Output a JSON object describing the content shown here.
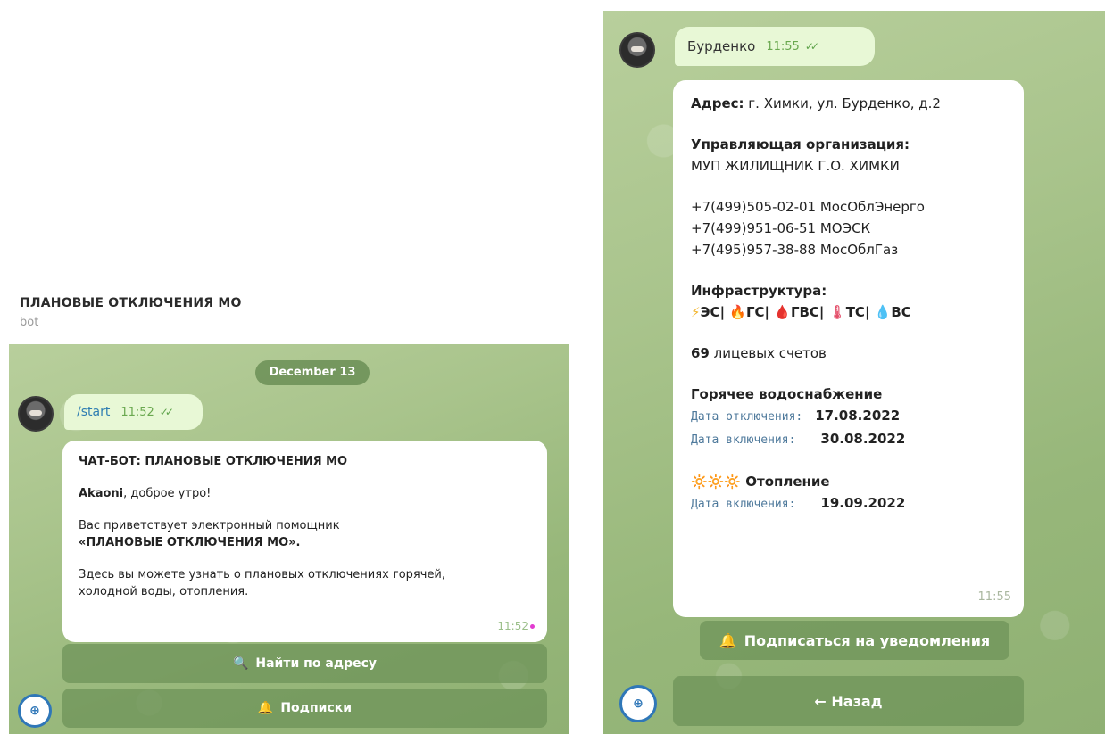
{
  "left": {
    "header": {
      "title": "ПЛАНОВЫЕ ОТКЛЮЧЕНИЯ МО",
      "subtitle": "bot"
    },
    "date_pill": "December 13",
    "outgoing": {
      "text": "/start",
      "time": "11:52",
      "check": "✓✓"
    },
    "message": {
      "title": "ЧАТ-БОТ: ПЛАНОВЫЕ ОТКЛЮЧЕНИЯ МО",
      "greeting_name": "Akaoni",
      "greeting_rest": ", доброе утро!",
      "line1": "Вас приветствует электронный помощник",
      "line2": "«ПЛАНОВЫЕ ОТКЛЮЧЕНИЯ МО».",
      "line3a": "Здесь вы можете узнать о плановых отключениях горячей,",
      "line3b": "холодной воды, отопления.",
      "time": "11:52"
    },
    "buttons": {
      "find": {
        "icon": "🔍",
        "label": "Найти по адресу"
      },
      "subs": {
        "icon": "🔔",
        "label": "Подписки"
      }
    },
    "bot_icon": "⊕"
  },
  "right": {
    "outgoing": {
      "text": "Бурденко",
      "time": "11:55",
      "check": "✓✓"
    },
    "message": {
      "address_label": "Адрес:",
      "address_value": " г. Химки, ул. Бурденко, д.2",
      "org_label": "Управляющая организация:",
      "org_value": "МУП ЖИЛИЩНИК Г.О. ХИМКИ",
      "phones": [
        "+7(499)505-02-01 МосОблЭнерго",
        "+7(499)951-06-51 МОЭСК",
        "+7(495)957-38-88 МосОблГаз"
      ],
      "infra_label": "Инфраструктура:",
      "infra": {
        "bolt": "⚡",
        "es": "ЭС|",
        "fire": "🔥",
        "gs": "ГС|",
        "drop": "🩸",
        "gvs": "ГВС|",
        "therm": "🌡",
        "ts": "ТС|",
        "water": "💧",
        "vs": "ВС"
      },
      "accounts_count": "69",
      "accounts_label": " лицевых счетов",
      "hot_water_label": "Горячее водоснабжение",
      "off_label": "Дата отключения:",
      "off_value": "17.08.2022",
      "on_label": "Дата включения:",
      "on_value": "30.08.2022",
      "heating_suns": "🔆🔆🔆",
      "heating_label": " Отопление",
      "heating_on_label": "Дата включения:",
      "heating_on_value": "19.09.2022",
      "time": "11:55"
    },
    "buttons": {
      "subscribe": {
        "icon": "🔔",
        "label": "Подписаться на уведомления"
      },
      "back": {
        "label": "← Назад"
      }
    },
    "bot_icon": "⊕"
  }
}
